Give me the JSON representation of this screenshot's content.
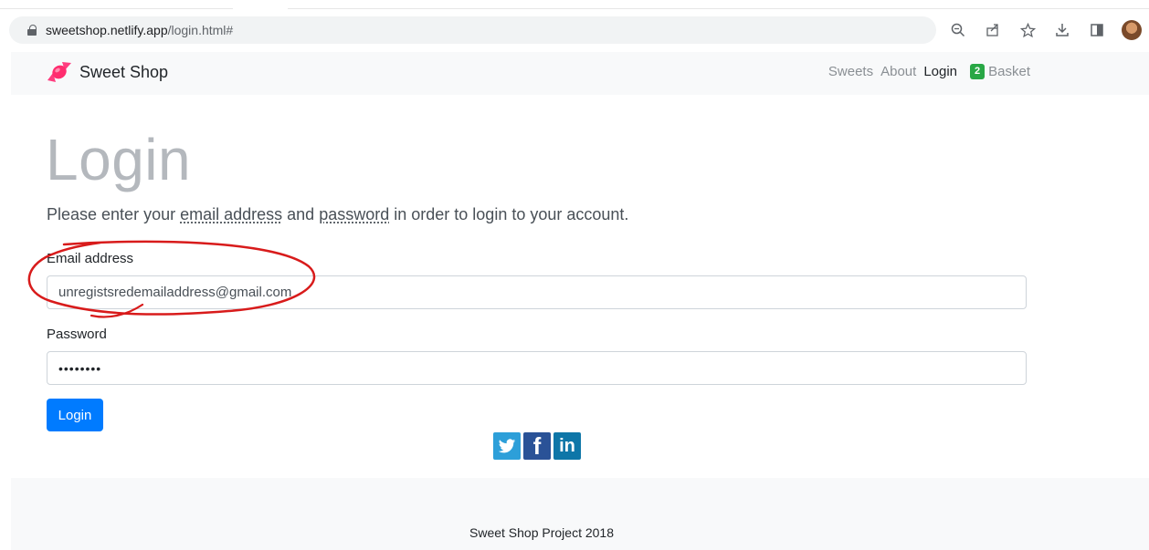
{
  "browser": {
    "url_host": "sweetshop.netlify.app",
    "url_path": "/login.html#",
    "icons": [
      "zoom-icon",
      "share-icon",
      "star-icon",
      "download-icon",
      "sidepanel-icon",
      "avatar",
      "menu-icon"
    ]
  },
  "navbar": {
    "brand": "Sweet Shop",
    "links": [
      {
        "label": "Sweets"
      },
      {
        "label": "About"
      },
      {
        "label": "Login"
      }
    ],
    "basket_count": "2",
    "basket_label": "Basket"
  },
  "main": {
    "title": "Login",
    "lead_prefix": "Please enter your ",
    "lead_email": "email address",
    "lead_and": " and ",
    "lead_password": "password",
    "lead_suffix": " in order to login to your account.",
    "email_label": "Email address",
    "email_value": "unregistsredemailaddress@gmail.com",
    "password_label": "Password",
    "password_value": "••••••••",
    "login_button": "Login"
  },
  "footer": {
    "text": "Sweet Shop Project 2018"
  },
  "colors": {
    "primary": "#007bff",
    "badge": "#28a745",
    "annotation": "#d81b1b"
  }
}
